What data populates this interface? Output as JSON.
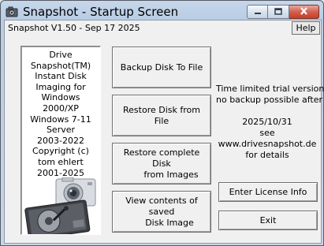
{
  "window": {
    "title": "Snapshot - Startup Screen"
  },
  "header": {
    "version_line": "Snapshot V1.50 - Sep 17 2025",
    "help_label": "Help"
  },
  "info_panel": {
    "lines": [
      "Drive",
      "Snapshot(TM)",
      "Instant Disk",
      "Imaging for",
      "Windows",
      "2000/XP",
      "Windows 7-11",
      "Server",
      "2003-2022",
      "Copyright (c)",
      "tom ehlert",
      "2001-2025"
    ]
  },
  "actions": {
    "backup": "Backup Disk To File",
    "restore_file": "Restore Disk from File",
    "restore_images_1": "Restore complete Disk",
    "restore_images_2": "from Images",
    "view_1": "View contents of saved",
    "view_2": "Disk Image"
  },
  "trial": {
    "line1": "Time limited trial version",
    "line2": "no backup possible after",
    "date": "2025/10/31",
    "see": "see",
    "url": "www.drivesnapshot.de",
    "details": "for details"
  },
  "side_buttons": {
    "license": "Enter License Info",
    "exit": "Exit"
  },
  "icons": {
    "app": "camera-icon",
    "minimize": "minimize-icon",
    "maximize": "maximize-icon",
    "close": "close-icon",
    "artwork": "camera-and-hard-drive-icon"
  }
}
